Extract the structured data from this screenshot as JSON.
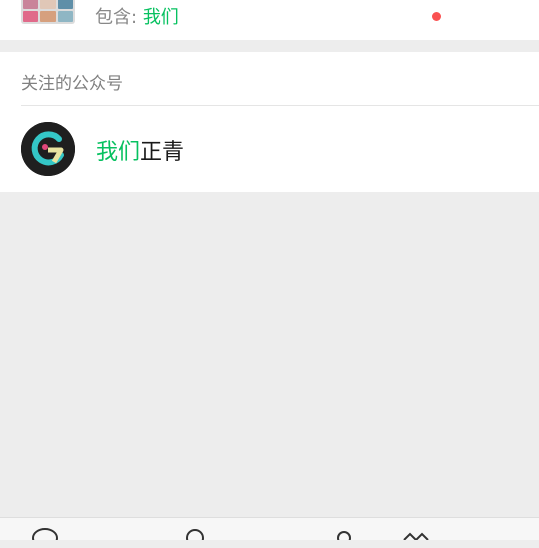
{
  "search_result_group": {
    "contains_label": "包含:",
    "contains_keyword": "我们"
  },
  "official_accounts": {
    "section_title": "关注的公众号",
    "items": [
      {
        "name_highlight": "我们",
        "name_rest": "正青"
      }
    ]
  },
  "tabbar": {
    "tabs": [
      {
        "icon": "chat-icon"
      },
      {
        "icon": "contacts-icon"
      },
      {
        "icon": "discover-icon"
      },
      {
        "icon": "me-icon",
        "has_badge": true
      }
    ],
    "badge_color": "#fa5151"
  },
  "colors": {
    "highlight": "#07c160",
    "background": "#ededed"
  }
}
